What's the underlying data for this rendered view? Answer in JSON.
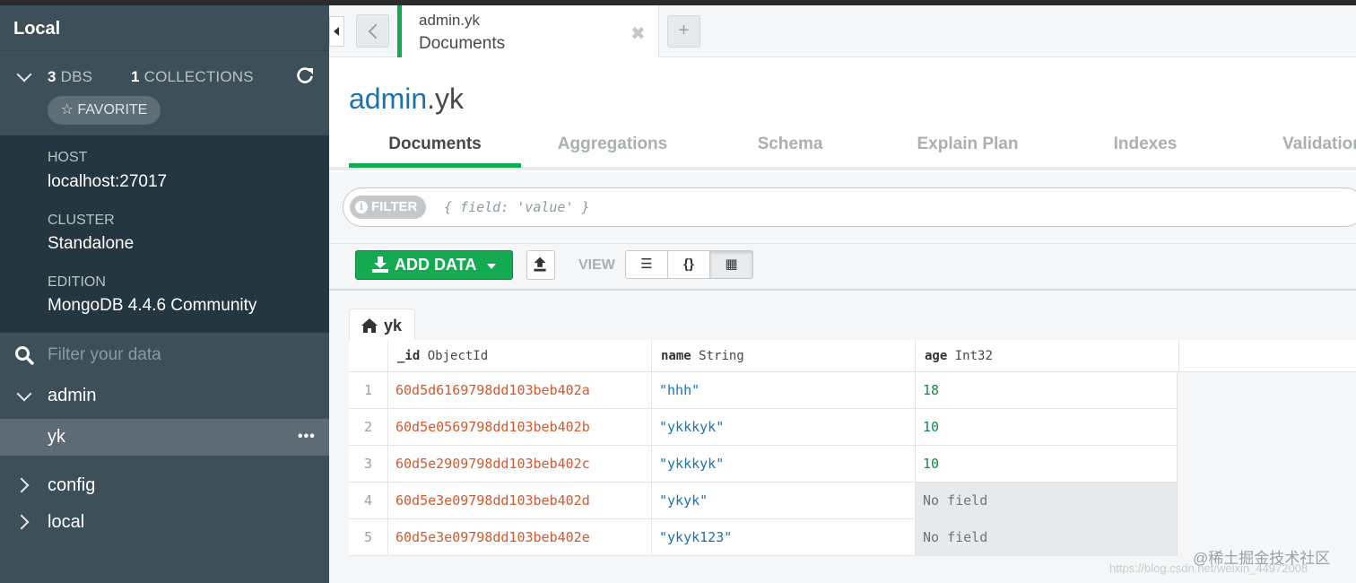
{
  "sidebar": {
    "title": "Local",
    "dbs_count": "3",
    "dbs_label": "DBS",
    "collections_count": "1",
    "collections_label": "COLLECTIONS",
    "favorite_label": "☆ FAVORITE",
    "host_label": "HOST",
    "host_value": "localhost:27017",
    "cluster_label": "CLUSTER",
    "cluster_value": "Standalone",
    "edition_label": "EDITION",
    "edition_value": "MongoDB 4.4.6 Community",
    "filter_placeholder": "Filter your data",
    "databases": [
      {
        "name": "admin",
        "expanded": true,
        "collections": [
          "yk"
        ]
      },
      {
        "name": "config",
        "expanded": false
      },
      {
        "name": "local",
        "expanded": false
      }
    ],
    "active_collection_menu": "•••"
  },
  "tab": {
    "namespace": "admin.yk",
    "subtitle": "Documents",
    "close": "✖",
    "add": "+"
  },
  "header": {
    "db": "admin",
    "coll": ".yk"
  },
  "subtabs": [
    "Documents",
    "Aggregations",
    "Schema",
    "Explain Plan",
    "Indexes",
    "Validation"
  ],
  "filter": {
    "pill_label": "FILTER",
    "info_glyph": "i",
    "placeholder": "{ field: 'value' }"
  },
  "toolbar": {
    "add_data_label": "ADD DATA",
    "view_label": "VIEW",
    "view_list": "☰",
    "view_json": "{}",
    "view_table": "▦"
  },
  "grid": {
    "tab_label": "yk",
    "columns": [
      {
        "field": "_id",
        "type": "ObjectId"
      },
      {
        "field": "name",
        "type": "String"
      },
      {
        "field": "age",
        "type": "Int32"
      }
    ],
    "rows": [
      {
        "n": "1",
        "id": "60d5d6169798dd103beb402a",
        "name": "\"hhh\"",
        "age": "18"
      },
      {
        "n": "2",
        "id": "60d5e0569798dd103beb402b",
        "name": "\"ykkkyk\"",
        "age": "10"
      },
      {
        "n": "3",
        "id": "60d5e2909798dd103beb402c",
        "name": "\"ykkkyk\"",
        "age": "10"
      },
      {
        "n": "4",
        "id": "60d5e3e09798dd103beb402d",
        "name": "\"ykyk\"",
        "age": "No field"
      },
      {
        "n": "5",
        "id": "60d5e3e09798dd103beb402e",
        "name": "\"ykyk123\"",
        "age": "No field"
      }
    ]
  },
  "watermark": "@稀土掘金技术社区",
  "watermark_url": "https://blog.csdn.net/weixin_44972008",
  "colors": {
    "accent_green": "#13aa52",
    "sidebar_bg": "#3d4f58",
    "sidebar_info_bg": "#243640",
    "objectid": "#d15a2f",
    "string": "#1a73b0"
  }
}
